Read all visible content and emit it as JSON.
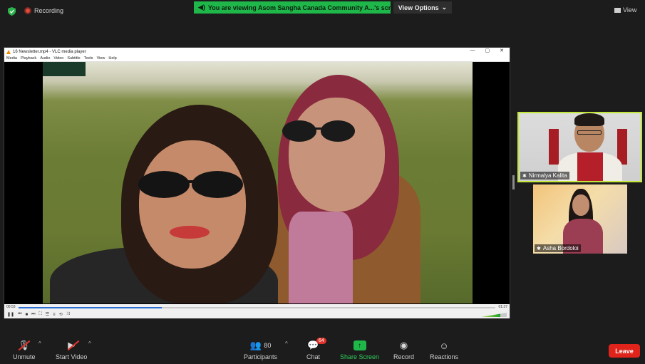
{
  "top": {
    "recording_label": "Recording",
    "share_banner": "You are viewing Asom Sangha Canada Community A...'s screen",
    "view_options": "View Options",
    "view_label": "View"
  },
  "vlc": {
    "title": "16 Newsletter.mp4 - VLC media player",
    "menu": [
      "Media",
      "Playback",
      "Audio",
      "Video",
      "Subtitle",
      "Tools",
      "View",
      "Help"
    ],
    "time_elapsed": "00:53",
    "time_total": "01:37",
    "progress_fraction": 0.3
  },
  "participants": [
    {
      "name": "Nirmalya Kalita",
      "active_speaker": true
    },
    {
      "name": "Asha Bordoloi",
      "active_speaker": false
    }
  ],
  "toolbar": {
    "unmute": "Unmute",
    "start_video": "Start Video",
    "participants": "Participants",
    "participants_count": "80",
    "chat": "Chat",
    "chat_badge": "64",
    "share_screen": "Share Screen",
    "record": "Record",
    "reactions": "Reactions",
    "leave": "Leave"
  },
  "colors": {
    "share_green": "#1fb74a",
    "leave_red": "#e0241b",
    "active_speaker_border": "#c3e63a"
  }
}
